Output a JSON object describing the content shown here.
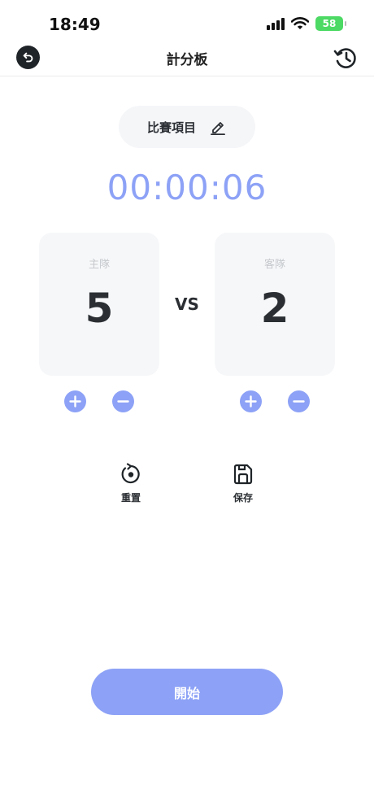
{
  "status_bar": {
    "time": "18:49",
    "battery": "58"
  },
  "nav": {
    "title": "計分板"
  },
  "event": {
    "label": "比賽項目"
  },
  "timer": {
    "value": "00:00:06"
  },
  "home": {
    "name": "主隊",
    "score": "5"
  },
  "away": {
    "name": "客隊",
    "score": "2"
  },
  "vs_label": "VS",
  "actions": {
    "reset_label": "重置",
    "save_label": "保存"
  },
  "start_button": {
    "label": "開始"
  },
  "colors": {
    "accent": "#8da2f6",
    "dark": "#1f2428",
    "card": "#f6f7f9",
    "battery": "#4cd964"
  },
  "icons": [
    "back-icon",
    "history-icon",
    "edit-icon",
    "plus-icon",
    "minus-icon",
    "reset-icon",
    "save-icon",
    "signal-icon",
    "wifi-icon",
    "battery-icon"
  ]
}
